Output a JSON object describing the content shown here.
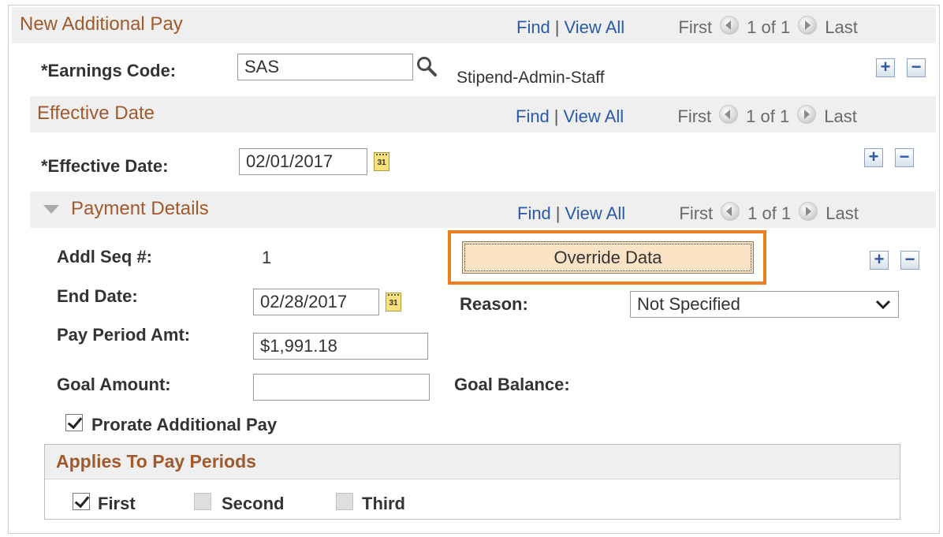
{
  "nav": {
    "find": "Find",
    "view_all": "View All",
    "first": "First",
    "count": "1 of 1",
    "last": "Last"
  },
  "sections": {
    "new_additional_pay": "New Additional Pay",
    "effective_date": "Effective Date",
    "payment_details": "Payment Details",
    "applies_to_pay_periods": "Applies To Pay Periods"
  },
  "earnings": {
    "label": "*Earnings Code:",
    "value": "SAS",
    "description": "Stipend-Admin-Staff"
  },
  "effective": {
    "label": "*Effective Date:",
    "value": "02/01/2017"
  },
  "payment": {
    "addl_seq_label": "Addl Seq #:",
    "addl_seq_value": "1",
    "override_button": "Override Data",
    "end_date_label": "End Date:",
    "end_date_value": "02/28/2017",
    "reason_label": "Reason:",
    "reason_value": "Not Specified",
    "pay_period_amt_label": "Pay Period Amt:",
    "pay_period_amt_value": "$1,991.18",
    "goal_amount_label": "Goal Amount:",
    "goal_amount_value": "",
    "goal_balance_label": "Goal Balance:",
    "prorate_label": "Prorate Additional Pay",
    "prorate_checked": true
  },
  "pay_periods": [
    {
      "label": "First",
      "checked": true,
      "enabled": true
    },
    {
      "label": "Second",
      "checked": false,
      "enabled": false
    },
    {
      "label": "Third",
      "checked": false,
      "enabled": false
    }
  ],
  "icons": {
    "lookup": "magnifier-icon",
    "calendar": "calendar-icon",
    "add": "plus-icon",
    "delete": "minus-icon",
    "prev": "prev-circle-icon",
    "next": "next-circle-icon"
  },
  "calendar_glyph": "31",
  "colors": {
    "section_title": "#a05a2c",
    "link": "#2a5aa6",
    "header_bg": "#efefef",
    "highlight": "#ef7d22",
    "button_bg": "#fae3c4"
  }
}
